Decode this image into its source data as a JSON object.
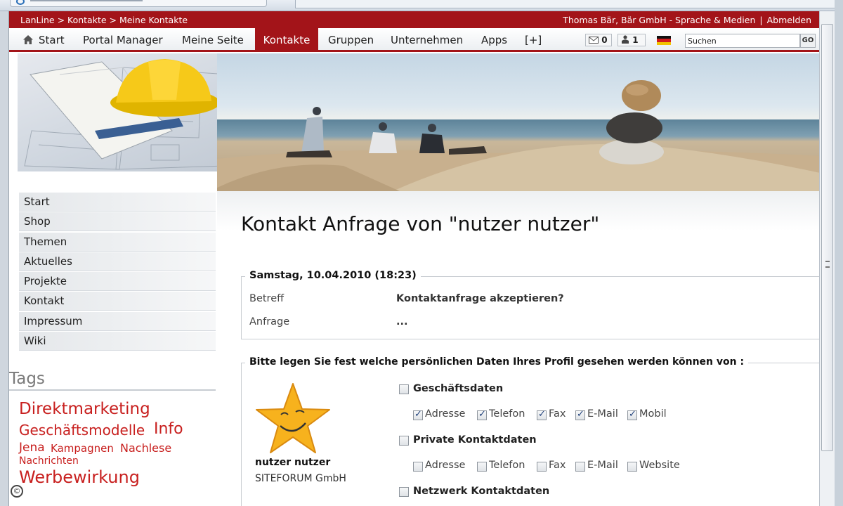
{
  "breadcrumb": "LanLine > Kontakte > Meine Kontakte",
  "user_bar": {
    "user": "Thomas Bär, Bär GmbH - Sprache & Medien",
    "separator": "|",
    "logout": "Abmelden"
  },
  "nav": {
    "items": [
      "Start",
      "Portal Manager",
      "Meine Seite",
      "Kontakte",
      "Gruppen",
      "Unternehmen",
      "Apps",
      "[+]"
    ],
    "active": "Kontakte",
    "messages_count": "0",
    "requests_count": "1",
    "language": "de-flag-icon",
    "search_value": "Suchen",
    "go_label": "GO"
  },
  "sidebar": {
    "items": [
      "Start",
      "Shop",
      "Themen",
      "Aktuelles",
      "Projekte",
      "Kontakt",
      "Impressum",
      "Wiki"
    ],
    "tags_heading": "Tags",
    "tags": [
      "Direktmarketing",
      "Geschäftsmodelle",
      "Info",
      "Jena",
      "Kampagnen",
      "Nachlese",
      "Nachrichten",
      "Werbewirkung"
    ]
  },
  "main": {
    "title": "Kontakt Anfrage von \"nutzer nutzer\"",
    "request": {
      "date": "Samstag, 10.04.2010 (18:23)",
      "subject_label": "Betreff",
      "subject": "Kontaktanfrage akzeptieren?",
      "request_label": "Anfrage",
      "request_text": "..."
    },
    "permissions": {
      "legend": "Bitte legen Sie fest welche persönlichen Daten Ihres Profil gesehen werden können von :",
      "user_name": "nutzer nutzer",
      "user_company": "SITEFORUM GmbH",
      "groups": [
        {
          "label": "Geschäftsdaten",
          "checked": false,
          "fields": [
            {
              "label": "Adresse",
              "checked": true
            },
            {
              "label": "Telefon",
              "checked": true
            },
            {
              "label": "Fax",
              "checked": true
            },
            {
              "label": "E-Mail",
              "checked": true
            },
            {
              "label": "Mobil",
              "checked": true
            }
          ]
        },
        {
          "label": "Private Kontaktdaten",
          "checked": false,
          "fields": [
            {
              "label": "Adresse",
              "checked": false
            },
            {
              "label": "Telefon",
              "checked": false
            },
            {
              "label": "Fax",
              "checked": false
            },
            {
              "label": "E-Mail",
              "checked": false
            },
            {
              "label": "Website",
              "checked": false
            }
          ]
        },
        {
          "label": "Netzwerk Kontaktdaten",
          "checked": false,
          "fields": []
        }
      ]
    }
  },
  "colors": {
    "brand_red": "#a31419",
    "tag_red": "#c8201f"
  }
}
